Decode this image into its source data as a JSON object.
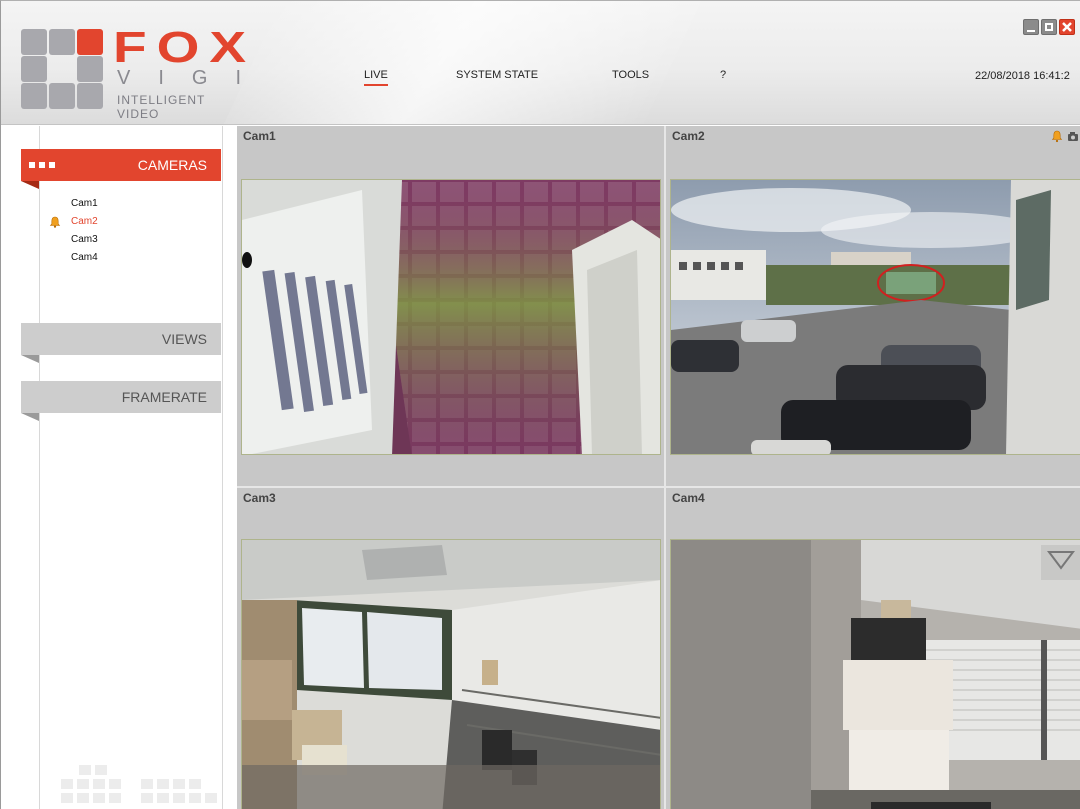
{
  "app": {
    "brand": "FOX",
    "subbrand": "VIGI",
    "tagline": "INTELLIGENT VIDEO"
  },
  "nav": {
    "items": [
      {
        "label": "LIVE",
        "active": true
      },
      {
        "label": "SYSTEM STATE",
        "active": false
      },
      {
        "label": "TOOLS",
        "active": false
      },
      {
        "label": "?",
        "active": false
      }
    ]
  },
  "datetime": "22/08/2018 16:41:2",
  "sidebar": {
    "cameras_label": "CAMERAS",
    "views_label": "VIEWS",
    "framerate_label": "FRAMERATE",
    "cameras": [
      {
        "name": "Cam1",
        "alert": false
      },
      {
        "name": "Cam2",
        "alert": true
      },
      {
        "name": "Cam3",
        "alert": false
      },
      {
        "name": "Cam4",
        "alert": false
      }
    ]
  },
  "tiles": [
    {
      "title": "Cam1",
      "alert_icons": false
    },
    {
      "title": "Cam2",
      "alert_icons": true
    },
    {
      "title": "Cam3",
      "alert_icons": false
    },
    {
      "title": "Cam4",
      "alert_icons": false
    }
  ],
  "colors": {
    "accent": "#e2452e",
    "panel_gray": "#cdcdcd"
  },
  "icons": {
    "alarm": "alarm-bell-icon",
    "camera": "camera-icon"
  }
}
